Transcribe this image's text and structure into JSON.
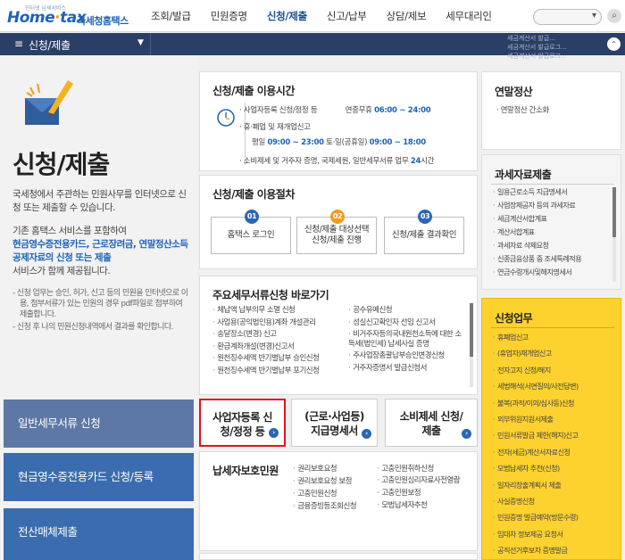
{
  "header": {
    "logo_small": "인터넷 납세서비스",
    "logo_brand_a": "Home",
    "logo_brand_dot": "·",
    "logo_brand_b": "tax",
    "logo_kor": "국세청홈택스",
    "nav": [
      "조회/발급",
      "민원증명",
      "신청/제출",
      "신고/납부",
      "상담/제보",
      "세무대리인"
    ],
    "nav_active": "신청/제출"
  },
  "subbar": {
    "title": "신청/제출",
    "ticker": [
      "세금계산서 발급...",
      "세금계산서 발급로그...",
      "세금계산서 발급로그..."
    ]
  },
  "left": {
    "title": "신청/제출",
    "intro": "국세청에서 주관하는 민원사무를 인터넷으로 신청 또는 제출할 수 있습니다.",
    "p2_a": "기존 홈택스 서비스를 포함하여",
    "p2_hl": "현금영수증전용카드, 근로장려금, 연말정산소득공제자료의 신청 또는 제출",
    "p2_b": "서비스가 함께 제공됩니다.",
    "note1": "- 신청 업무는 승인, 허가, 신고 등의 민원을 인터넷으로 이용, 첨부서류가 있는 민원의 경우 pdf파일로 첨부하여 제출합니다.",
    "note2": "- 신청 후 나의 민원신청내역에서 결과를 확인합니다.",
    "buttons": [
      "일반세무서류 신청",
      "현금영수증전용카드 신청/등록",
      "전산매체제출"
    ]
  },
  "time": {
    "title": "신청/제출 이용시간",
    "row1_a": "· 사업자등록 신청/정정 등",
    "row1_b": "연중무휴",
    "row1_c": "06:00 ~ 24:00",
    "row2": "· 휴·폐업 및 재개업신고",
    "row3_a": "평일",
    "row3_b": "09:00 ~ 23:00",
    "row3_c": "토·일(공휴일)",
    "row3_d": "09:00 ~ 18:00",
    "row4_a": "· 소비제세 및 거주자 증명, 국제세원, 일반세무서류 업무",
    "row4_b": "24",
    "row4_c": "시간"
  },
  "procedure": {
    "title": "신청/제출 이용절차",
    "steps": [
      {
        "num": "01",
        "label": "홈택스 로그인"
      },
      {
        "num": "02",
        "label": "신청/제출 대상선택 신청/제출 진행"
      },
      {
        "num": "03",
        "label": "신청/제출 결과확인"
      }
    ]
  },
  "docs": {
    "title": "주요세무서류신청 바로가기",
    "col1": [
      "체납액 납부의무 소멸 신청",
      "사업용(공익법인용)계좌 개설관리",
      "송달장소(변경) 신고",
      "환급계좌개설(변경)신고서",
      "원천징수세액 반기별납부 승인신청",
      "원천징수세액 반기별납부 포기신청"
    ],
    "col2": [
      "공수유예신청",
      "성실신고확인자 선임 신고서",
      "비거주자등의국내원천소득에 대한 소득세(법인세) 납세사실 증명",
      "주사업장총괄납부승인변경신청",
      "거주자증명서 발급신청서"
    ]
  },
  "tiles": [
    {
      "label": "사업자등록 신청/정정 등"
    },
    {
      "label": "(근로·사업등) 지급명세서"
    },
    {
      "label": "소비제세 신청/제출"
    }
  ],
  "protect": {
    "title": "납세자보호민원",
    "col1": [
      "권리보호요청",
      "권리보호요청 보정",
      "고충민원신청",
      "금융증빙등조회신청"
    ],
    "col2": [
      "고충민원취하신청",
      "고충민원심리자료사전열람",
      "고충민원보정",
      "모범납세자추천"
    ]
  },
  "right": {
    "year_title": "연말정산",
    "year_item": "· 연말정산 간소화",
    "tax_title": "과세자료제출",
    "tax_items": [
      "일용근로소득 지급명세서",
      "사업장제공자 등의 과세자료",
      "세금계산서합계표",
      "계산서합계표",
      "과세자료 삭제요청",
      "신종금융상품 중 조세특례적용",
      "연금수령개시및해지명세서"
    ],
    "app_title": "신청업무",
    "app_items": [
      "휴폐업신고",
      "(휴업자)재개업신고",
      "전자고지 신청/해지",
      "세법해석(서면질의/사전답변)",
      "불복(과적/이의/심사등)신청",
      "외부위원지원서제출",
      "민원서류발급 제한(해지)신고",
      "전자(세금)계산서자료신청",
      "모범납세자 추천(신청)",
      "일자리창출계획서 제출",
      "사실증명신청",
      "민원증명 발급예약(방문수령)",
      "임대차 정보제공 요청서",
      "공직선거후보자 증명발급"
    ]
  },
  "colors": {
    "accent_blue": "#1d63b8",
    "nav_bar": "#2a3f66",
    "highlight_red": "#e0141e",
    "yellow_panel": "#fdd22e"
  }
}
